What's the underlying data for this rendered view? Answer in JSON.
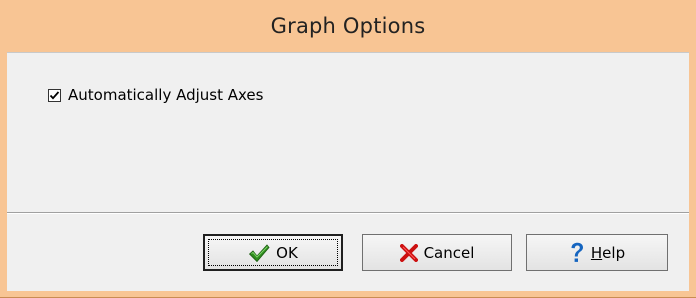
{
  "dialog": {
    "title": "Graph Options"
  },
  "options": {
    "auto_adjust_axes": {
      "label": "Automatically Adjust Axes",
      "checked": true
    }
  },
  "buttons": {
    "ok": {
      "label": "OK",
      "icon": "checkmark-icon",
      "icon_color": "#2e8b1e"
    },
    "cancel": {
      "label": "Cancel",
      "icon": "red-x-icon",
      "icon_color": "#cc1010"
    },
    "help": {
      "mnemonic": "H",
      "rest": "elp",
      "icon": "question-mark-icon",
      "icon_color": "#1565c0"
    }
  },
  "colors": {
    "title_bar": "#f8c594",
    "client_background": "#f0f0f0"
  }
}
